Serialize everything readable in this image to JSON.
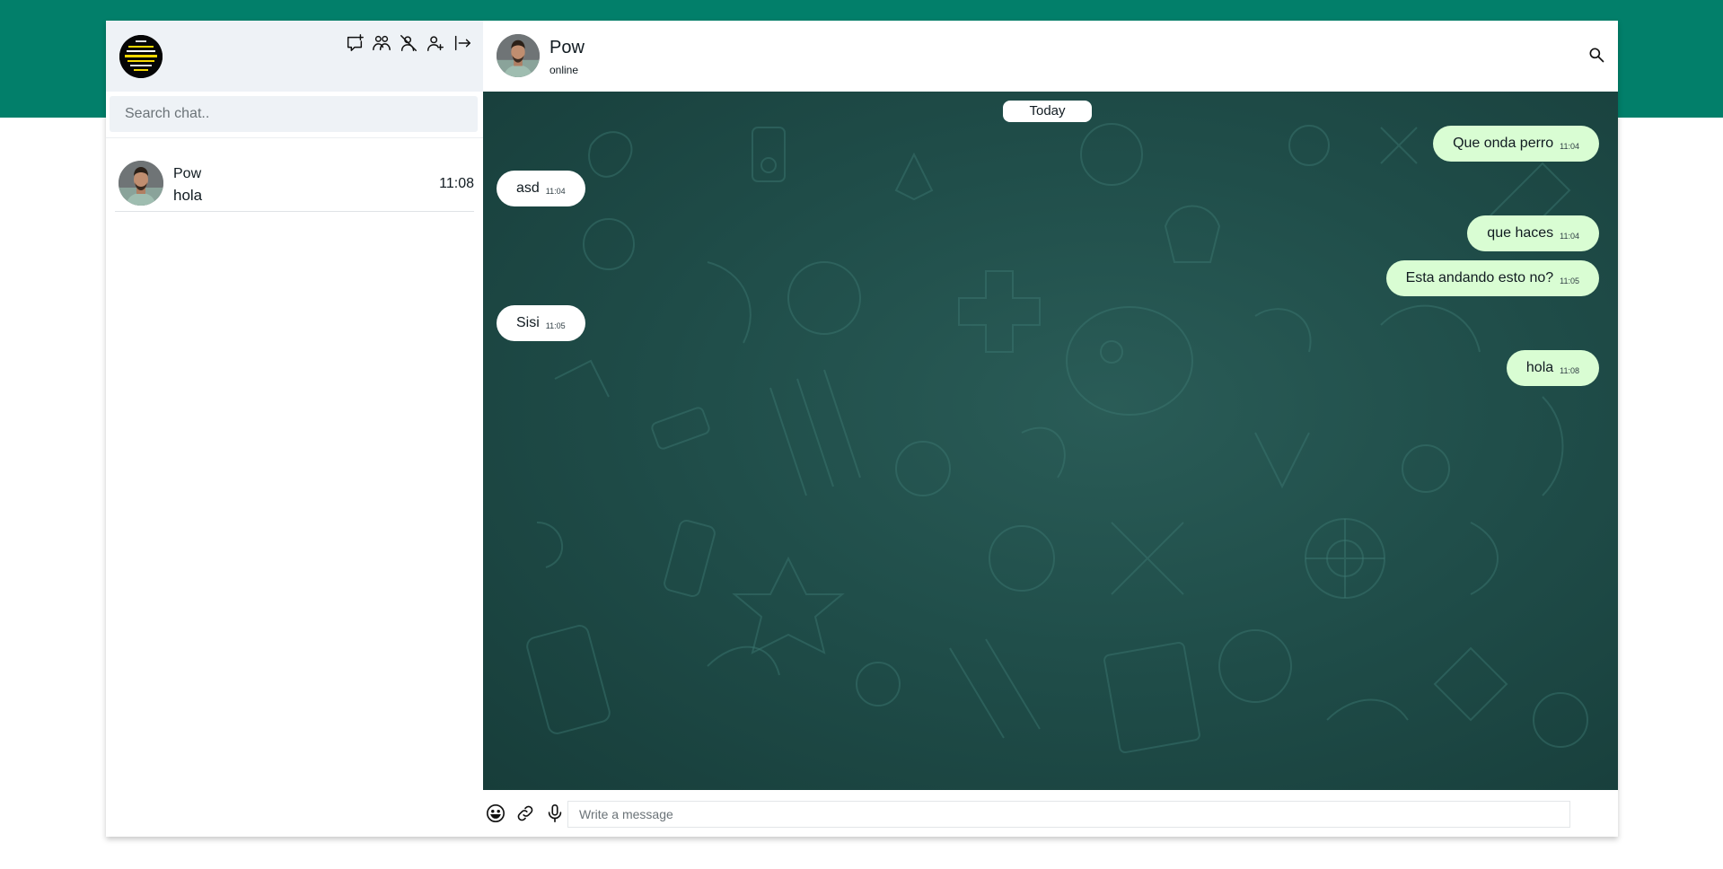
{
  "colors": {
    "accent_band": "#027f6a",
    "sidebar_header": "#eef2f6",
    "outgoing_bubble": "#d9fdd3",
    "incoming_bubble": "#ffffff",
    "chat_background": "#204e4a"
  },
  "sidebar": {
    "header_icons": [
      "new-chat-icon",
      "new-group-icon",
      "block-user-icon",
      "add-contact-icon",
      "logout-icon"
    ],
    "search": {
      "placeholder": "Search chat..",
      "value": ""
    },
    "chats": [
      {
        "name": "Pow",
        "last_message": "hola",
        "time": "11:08"
      }
    ]
  },
  "chat": {
    "contact": {
      "name": "Pow",
      "status": "online"
    },
    "date_label": "Today",
    "messages": [
      {
        "direction": "out",
        "text": "Que onda perro",
        "time": "11:04"
      },
      {
        "direction": "in",
        "text": "asd",
        "time": "11:04"
      },
      {
        "direction": "out",
        "text": "que haces",
        "time": "11:04"
      },
      {
        "direction": "out",
        "text": "Esta andando esto no?",
        "time": "11:05"
      },
      {
        "direction": "in",
        "text": "Sisi",
        "time": "11:05"
      },
      {
        "direction": "out",
        "text": "hola",
        "time": "11:08"
      }
    ]
  },
  "composer": {
    "icons": [
      "emoji-icon",
      "attach-link-icon",
      "microphone-icon"
    ],
    "placeholder": "Write a message",
    "value": ""
  }
}
